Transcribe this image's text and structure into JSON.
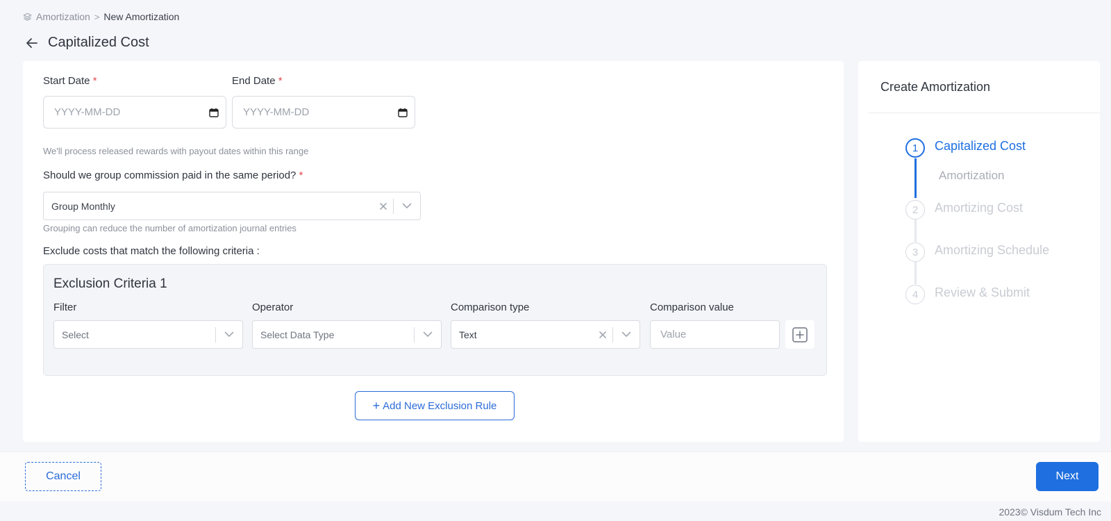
{
  "breadcrumb": {
    "root": "Amortization",
    "separator": ">",
    "current": "New Amortization"
  },
  "page": {
    "title": "Capitalized Cost"
  },
  "form": {
    "start_date": {
      "label": "Start Date",
      "required_mark": "*",
      "placeholder": "YYYY-MM-DD"
    },
    "end_date": {
      "label": "End Date",
      "required_mark": "*",
      "placeholder": "YYYY-MM-DD"
    },
    "date_hint": "We'll process released rewards with payout dates within this range",
    "group_question": {
      "label": "Should we group commission paid in the same period?",
      "required_mark": "*",
      "value": "Group Monthly"
    },
    "group_hint": "Grouping can reduce the number of amortization journal entries",
    "exclude_label": "Exclude costs that match the following criteria :",
    "criteria": {
      "title": "Exclusion Criteria 1",
      "filter": {
        "label": "Filter",
        "value": "Select"
      },
      "operator": {
        "label": "Operator",
        "value": "Select Data Type"
      },
      "comparison_type": {
        "label": "Comparison type",
        "value": "Text"
      },
      "comparison_value": {
        "label": "Comparison value",
        "placeholder": "Value"
      }
    },
    "add_rule_label": "Add New Exclusion Rule"
  },
  "sidebar": {
    "title": "Create Amortization",
    "steps": [
      {
        "number": "1",
        "label": "Capitalized Cost",
        "state": "active",
        "substep": "Amortization"
      },
      {
        "number": "2",
        "label": "Amortizing Cost",
        "state": "inactive"
      },
      {
        "number": "3",
        "label": "Amortizing Schedule",
        "state": "inactive"
      },
      {
        "number": "4",
        "label": "Review & Submit",
        "state": "inactive"
      }
    ]
  },
  "footer": {
    "cancel_label": "Cancel",
    "next_label": "Next",
    "copyright": "2023© Visdum Tech Inc"
  },
  "colors": {
    "primary": "#1f6fe0",
    "required": "#e5484d",
    "inactive_step": "#c9ccd3"
  }
}
